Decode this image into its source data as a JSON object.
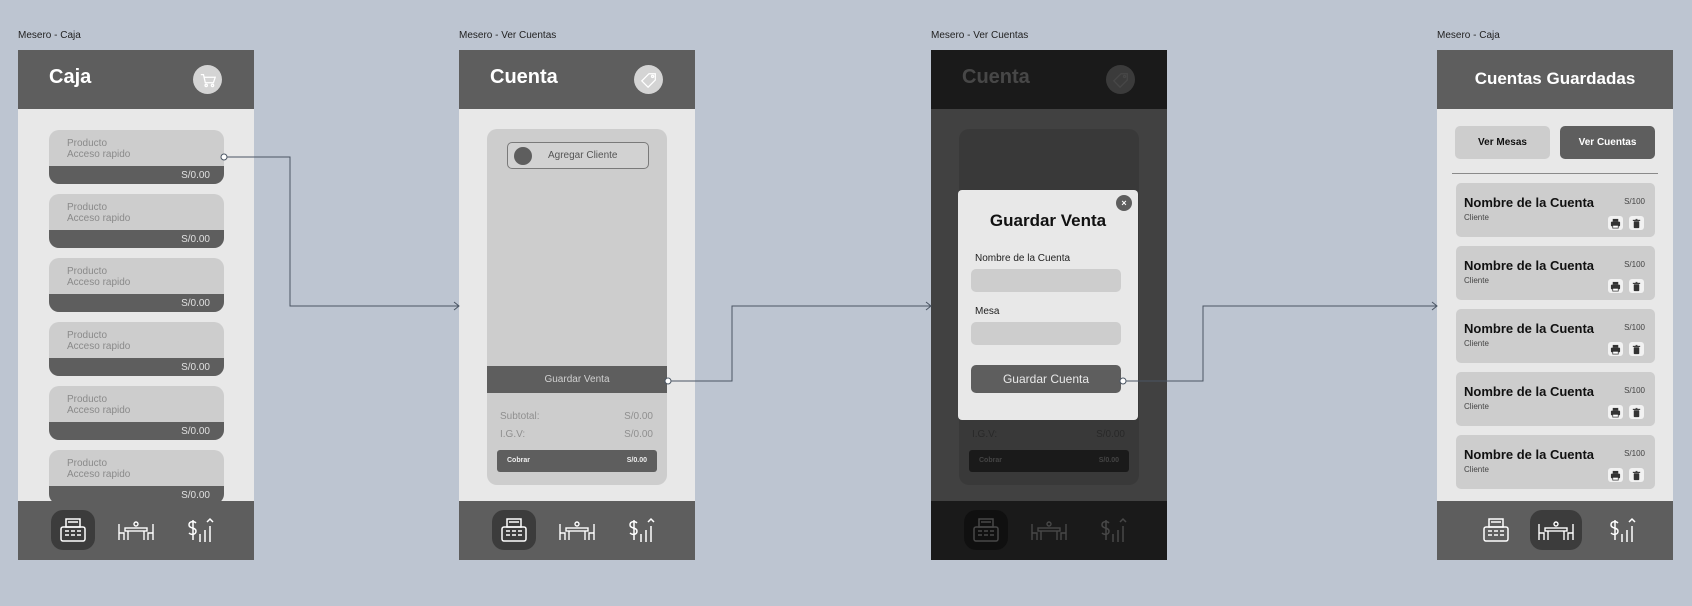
{
  "labels": {
    "f1": "Mesero - Caja",
    "f2": "Mesero - Ver Cuentas",
    "f3": "Mesero - Ver Cuentas",
    "f4": "Mesero - Caja"
  },
  "caja": {
    "title": "Caja",
    "header_icon": "cart-icon",
    "products": [
      {
        "name": "Producto",
        "sub": "Acceso rapido",
        "price": "S/0.00"
      },
      {
        "name": "Producto",
        "sub": "Acceso rapido",
        "price": "S/0.00"
      },
      {
        "name": "Producto",
        "sub": "Acceso rapido",
        "price": "S/0.00"
      },
      {
        "name": "Producto",
        "sub": "Acceso rapido",
        "price": "S/0.00"
      },
      {
        "name": "Producto",
        "sub": "Acceso rapido",
        "price": "S/0.00"
      },
      {
        "name": "Producto",
        "sub": "Acceso rapido",
        "price": "S/0.00"
      }
    ]
  },
  "cuenta": {
    "title": "Cuenta",
    "header_icon": "tag-icon",
    "add_client": "Agregar Cliente",
    "save_sale": "Guardar Venta",
    "subtotal_label": "Subtotal:",
    "subtotal_value": "S/0.00",
    "igv_label": "I.G.V:",
    "igv_value": "S/0.00",
    "charge_label": "Cobrar",
    "charge_value": "S/0.00"
  },
  "modal": {
    "close": "×",
    "title": "Guardar Venta",
    "name_label": "Nombre de la Cuenta",
    "table_label": "Mesa",
    "submit": "Guardar Cuenta"
  },
  "saved": {
    "title": "Cuentas Guardadas",
    "tab_tables": "Ver Mesas",
    "tab_accounts": "Ver Cuentas",
    "accounts": [
      {
        "name": "Nombre de la Cuenta",
        "total": "S/100",
        "client": "Cliente"
      },
      {
        "name": "Nombre de la Cuenta",
        "total": "S/100",
        "client": "Cliente"
      },
      {
        "name": "Nombre de la Cuenta",
        "total": "S/100",
        "client": "Cliente"
      },
      {
        "name": "Nombre de la Cuenta",
        "total": "S/100",
        "client": "Cliente"
      },
      {
        "name": "Nombre de la Cuenta",
        "total": "S/100",
        "client": "Cliente"
      }
    ]
  },
  "nav": [
    "cash-register-icon",
    "dining-table-icon",
    "sales-growth-icon"
  ],
  "colors": {
    "canvas": "#bdc5d1",
    "header": "#5e5e5e",
    "screen": "#e8e8e8",
    "card": "#cdcdcd",
    "active_nav": "#3c3c3c"
  }
}
